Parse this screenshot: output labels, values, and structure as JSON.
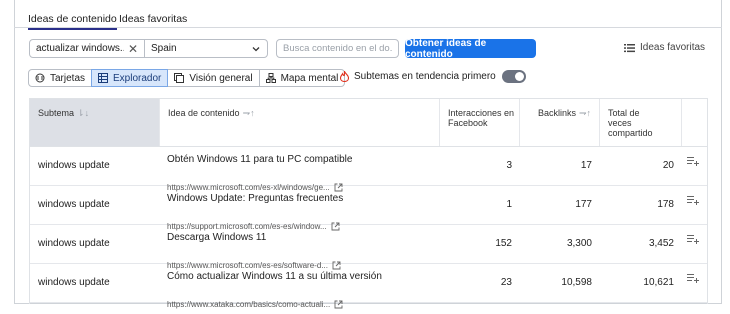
{
  "tabs": [
    {
      "label": "Ideas de contenido",
      "active": true
    },
    {
      "label": "Ideas favoritas",
      "active": false
    }
  ],
  "controls": {
    "keyword_value": "actualizar windows...",
    "country_value": "Spain",
    "search_placeholder": "Busca contenido en el do...",
    "submit_label": "Obtener ideas de contenido",
    "favorites_link": "Ideas favoritas"
  },
  "views": [
    {
      "label": "Tarjetas",
      "icon": "cards-icon",
      "active": false
    },
    {
      "label": "Explorador",
      "icon": "table-icon",
      "active": true
    },
    {
      "label": "Visión general",
      "icon": "overview-icon",
      "active": false
    },
    {
      "label": "Mapa mental",
      "icon": "mindmap-icon",
      "active": false
    }
  ],
  "trending": {
    "label": "Subtemas en tendencia primero",
    "enabled": false
  },
  "table": {
    "headers": {
      "subtopic": "Subtema",
      "idea": "Idea de contenido",
      "facebook": "Interacciones en Facebook",
      "backlinks": "Backlinks",
      "shares": "Total de veces compartido"
    },
    "rows": [
      {
        "subtopic": "windows update",
        "title": "Obtén Windows 11 para tu PC compatible",
        "url": "https://www.microsoft.com/es-xl/windows/ge...",
        "facebook": "3",
        "backlinks": "17",
        "shares": "20"
      },
      {
        "subtopic": "windows update",
        "title": "Windows Update: Preguntas frecuentes",
        "url": "https://support.microsoft.com/es-es/window...",
        "facebook": "1",
        "backlinks": "177",
        "shares": "178"
      },
      {
        "subtopic": "windows update",
        "title": "Descarga Windows 11",
        "url": "https://www.microsoft.com/es-es/software-d...",
        "facebook": "152",
        "backlinks": "3,300",
        "shares": "3,452"
      },
      {
        "subtopic": "windows update",
        "title": "Cómo actualizar Windows 11 a su última versión",
        "url": "https://www.xataka.com/basics/como-actuali...",
        "facebook": "23",
        "backlinks": "10,598",
        "shares": "10,621"
      }
    ]
  },
  "colors": {
    "accent": "#1a73e8",
    "active_view_bg": "#d7e6fb",
    "sorted_header_bg": "#dde0e6"
  }
}
